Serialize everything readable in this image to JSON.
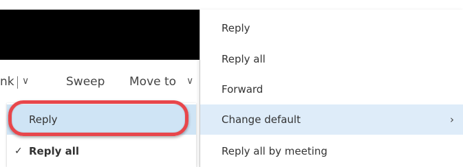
{
  "toolbar": {
    "junk_label": "nk",
    "sweep_label": "Sweep",
    "move_label": "Move to"
  },
  "reply_menu": {
    "items": [
      {
        "label": "Reply",
        "checked": false,
        "highlighted": true
      },
      {
        "label": "Reply all",
        "checked": true,
        "highlighted": false
      }
    ],
    "check_glyph": "✓"
  },
  "context_menu": {
    "items": [
      {
        "label": "Reply"
      },
      {
        "label": "Reply all"
      },
      {
        "label": "Forward"
      },
      {
        "label": "Change default",
        "has_submenu": true,
        "active": true
      },
      {
        "label": "Reply all by meeting"
      }
    ],
    "submenu_glyph": "›"
  },
  "colors": {
    "highlight_ring": "#e8464b",
    "selected_bg": "#cfe4f5",
    "active_bg": "#deecf9"
  }
}
